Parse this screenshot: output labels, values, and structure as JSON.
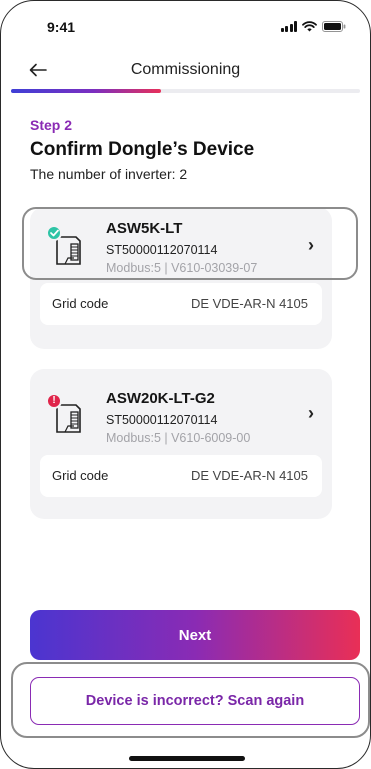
{
  "status_bar": {
    "time": "9:41"
  },
  "header": {
    "title": "Commissioning",
    "progress": 0.43
  },
  "step": {
    "label": "Step 2",
    "title": "Confirm Dongle’s Device",
    "inverter_count": "The number of inverter: 2"
  },
  "devices": [
    {
      "model": "ASW5K-LT",
      "serial": "ST50000112070114",
      "meta": "Modbus:5 | V610-03039-07",
      "status": "ok",
      "grid_label": "Grid code",
      "grid_value": "DE VDE-AR-N 4105"
    },
    {
      "model": "ASW20K-LT-G2",
      "serial": "ST50000112070114",
      "meta": "Modbus:5 | V610-6009-00",
      "status": "error",
      "status_glyph": "!",
      "grid_label": "Grid code",
      "grid_value": "DE VDE-AR-N 4105"
    }
  ],
  "buttons": {
    "next": "Next",
    "scan_again": "Device is incorrect? Scan again"
  },
  "colors": {
    "accent_purple": "#8a2ab4",
    "status_ok": "#2ec4a6",
    "status_error": "#e0244a",
    "gradient_start": "#4b35d0",
    "gradient_end": "#e92f56"
  },
  "icons": [
    "back-arrow-icon",
    "signal-icon",
    "wifi-icon",
    "battery-icon",
    "inverter-icon",
    "checkmark-icon",
    "chevron-right-icon"
  ]
}
